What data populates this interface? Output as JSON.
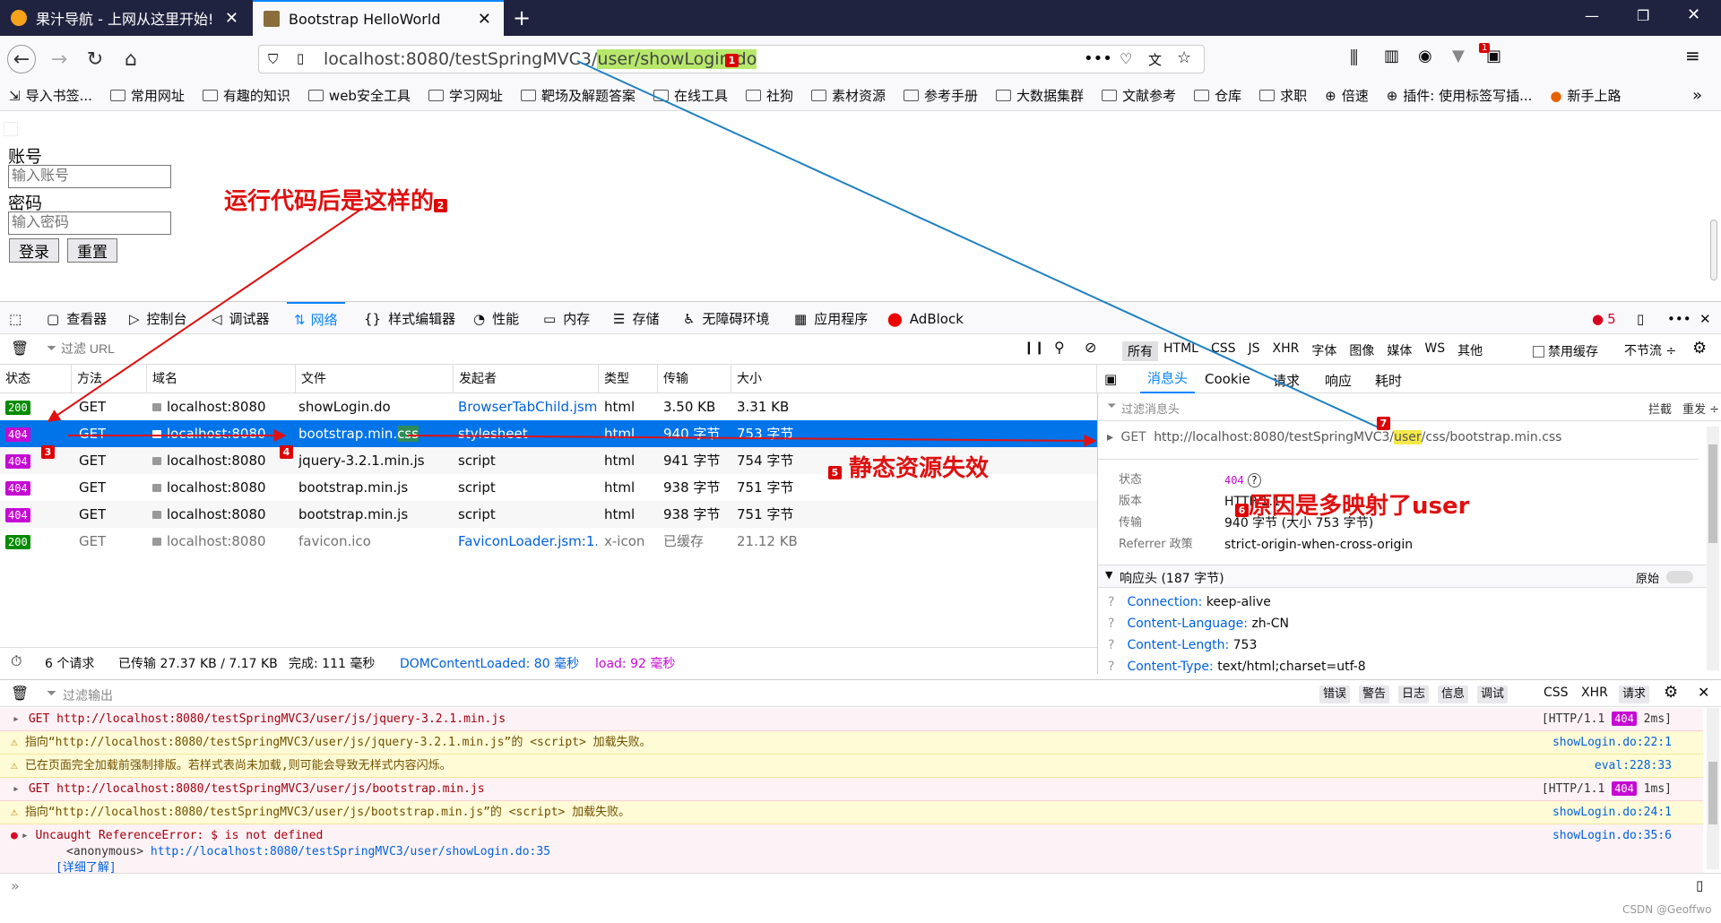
{
  "browser": {
    "tabs": [
      {
        "title": "果汁导航 - 上网从这里开始!",
        "active": false
      },
      {
        "title": "Bootstrap HelloWorld",
        "active": true
      }
    ],
    "url_prefix": "localhost:8080/testSpringMVC3/",
    "url_highlight": "user/showLogin.do",
    "bookmarks": [
      "导入书签...",
      "常用网址",
      "有趣的知识",
      "web安全工具",
      "学习网址",
      "靶场及解题答案",
      "在线工具",
      "社狗",
      "素材资源",
      "参考手册",
      "大数据集群",
      "文献参考",
      "仓库",
      "求职",
      "倍速",
      "插件: 使用标签写插...",
      "新手上路"
    ],
    "ext_badge": "1"
  },
  "page": {
    "account_label": "账号",
    "account_placeholder": "输入账号",
    "password_label": "密码",
    "password_placeholder": "输入密码",
    "login_button": "登录",
    "reset_button": "重置"
  },
  "devtools": {
    "tabs": [
      "查看器",
      "控制台",
      "调试器",
      "网络",
      "样式编辑器",
      "性能",
      "内存",
      "存储",
      "无障碍环境",
      "应用程序",
      "AdBlock"
    ],
    "active_tab": "网络",
    "error_count": "5",
    "filter_placeholder": "过滤 URL",
    "type_filters": [
      "所有",
      "HTML",
      "CSS",
      "JS",
      "XHR",
      "字体",
      "图像",
      "媒体",
      "WS",
      "其他"
    ],
    "disable_cache": "禁用缓存",
    "throttle": "不节流 ÷",
    "columns": [
      "状态",
      "方法",
      "域名",
      "文件",
      "发起者",
      "类型",
      "传输",
      "大小"
    ],
    "requests": [
      {
        "status": "200",
        "method": "GET",
        "domain": "localhost:8080",
        "file": "showLogin.do",
        "initiator": "BrowserTabChild.jsm...",
        "type": "html",
        "transfer": "3.50 KB",
        "size": "3.31 KB"
      },
      {
        "status": "404",
        "method": "GET",
        "domain": "localhost:8080",
        "file": "bootstrap.min.css",
        "initiator": "stylesheet",
        "type": "html",
        "transfer": "940 字节",
        "size": "753 字节"
      },
      {
        "status": "404",
        "method": "GET",
        "domain": "localhost:8080",
        "file": "jquery-3.2.1.min.js",
        "initiator": "script",
        "type": "html",
        "transfer": "941 字节",
        "size": "754 字节"
      },
      {
        "status": "404",
        "method": "GET",
        "domain": "localhost:8080",
        "file": "bootstrap.min.js",
        "initiator": "script",
        "type": "html",
        "transfer": "938 字节",
        "size": "751 字节"
      },
      {
        "status": "404",
        "method": "GET",
        "domain": "localhost:8080",
        "file": "bootstrap.min.js",
        "initiator": "script",
        "type": "html",
        "transfer": "938 字节",
        "size": "751 字节"
      },
      {
        "status": "200",
        "method": "GET",
        "domain": "localhost:8080",
        "file": "favicon.ico",
        "initiator": "FaviconLoader.jsm:1...",
        "type": "x-icon",
        "transfer": "已缓存",
        "size": "21.12 KB"
      }
    ],
    "summary": {
      "requests": "6 个请求",
      "transferred": "已传输 27.37 KB / 7.17 KB",
      "finish": "完成:  111 毫秒",
      "domcontent": "DOMContentLoaded: 80 毫秒",
      "load": "load: 92 毫秒"
    },
    "side_tabs": [
      "消息头",
      "Cookie",
      "请求",
      "响应",
      "耗时"
    ],
    "side_filter": "过滤消息头",
    "block": "拦截",
    "resend": "重发 ÷",
    "request_method": "GET",
    "request_url_a": "http://localhost:8080/testSpringMVC3/",
    "request_url_b": "user",
    "request_url_c": "/css/bootstrap.min.css",
    "details": [
      {
        "k": "状态",
        "v": "404"
      },
      {
        "k": "版本",
        "v": "HTTP/1.1"
      },
      {
        "k": "传输",
        "v": "940 字节 (大小 753 字节)"
      },
      {
        "k": "Referrer 政策",
        "v": "strict-origin-when-cross-origin"
      }
    ],
    "response_headers_title": "响应头 (187 字节)",
    "raw_label": "原始",
    "response_headers": [
      {
        "k": "Connection:",
        "v": "keep-alive"
      },
      {
        "k": "Content-Language:",
        "v": "zh-CN"
      },
      {
        "k": "Content-Length:",
        "v": "753"
      },
      {
        "k": "Content-Type:",
        "v": "text/html;charset=utf-8"
      }
    ]
  },
  "console": {
    "filter_placeholder": "过滤输出",
    "levels": [
      "错误",
      "警告",
      "日志",
      "信息",
      "调试"
    ],
    "extra": [
      "CSS",
      "XHR",
      "请求"
    ],
    "lines": [
      {
        "kind": "err",
        "text": "GET http://localhost:8080/testSpringMVC3/user/js/jquery-3.2.1.min.js",
        "src_a": "[HTTP/1.1 ",
        "src_badge": "404",
        "src_b": " 2ms]"
      },
      {
        "kind": "warn",
        "text": "指向“http://localhost:8080/testSpringMVC3/user/js/jquery-3.2.1.min.js”的 <script> 加载失败。",
        "src": "showLogin.do:22:1"
      },
      {
        "kind": "warn",
        "text": "已在页面完全加载前强制排版。若样式表尚未加载,则可能会导致无样式内容闪烁。",
        "src": "eval:228:33"
      },
      {
        "kind": "err",
        "text": "GET http://localhost:8080/testSpringMVC3/user/js/bootstrap.min.js",
        "src_a": "[HTTP/1.1 ",
        "src_badge": "404",
        "src_b": " 1ms]"
      },
      {
        "kind": "warn",
        "text": "指向“http://localhost:8080/testSpringMVC3/user/js/bootstrap.min.js”的 <script> 加载失败。",
        "src": "showLogin.do:24:1"
      },
      {
        "kind": "err",
        "text": "Uncaught ReferenceError: $ is not defined",
        "src": "showLogin.do:35:6"
      }
    ],
    "stack_fn": "<anonymous>",
    "stack_url": "http://localhost:8080/testSpringMVC3/user/showLogin.do:35",
    "learn_more": "[详细了解]"
  },
  "annotations": {
    "a2": "运行代码后是这样的",
    "a5": "静态资源失效",
    "a6": "原因是多映射了user",
    "n1": "1",
    "n2": "2",
    "n3": "3",
    "n4": "4",
    "n5": "5",
    "n6": "6",
    "n7": "7"
  },
  "watermark": "CSDN @Geoffwo"
}
